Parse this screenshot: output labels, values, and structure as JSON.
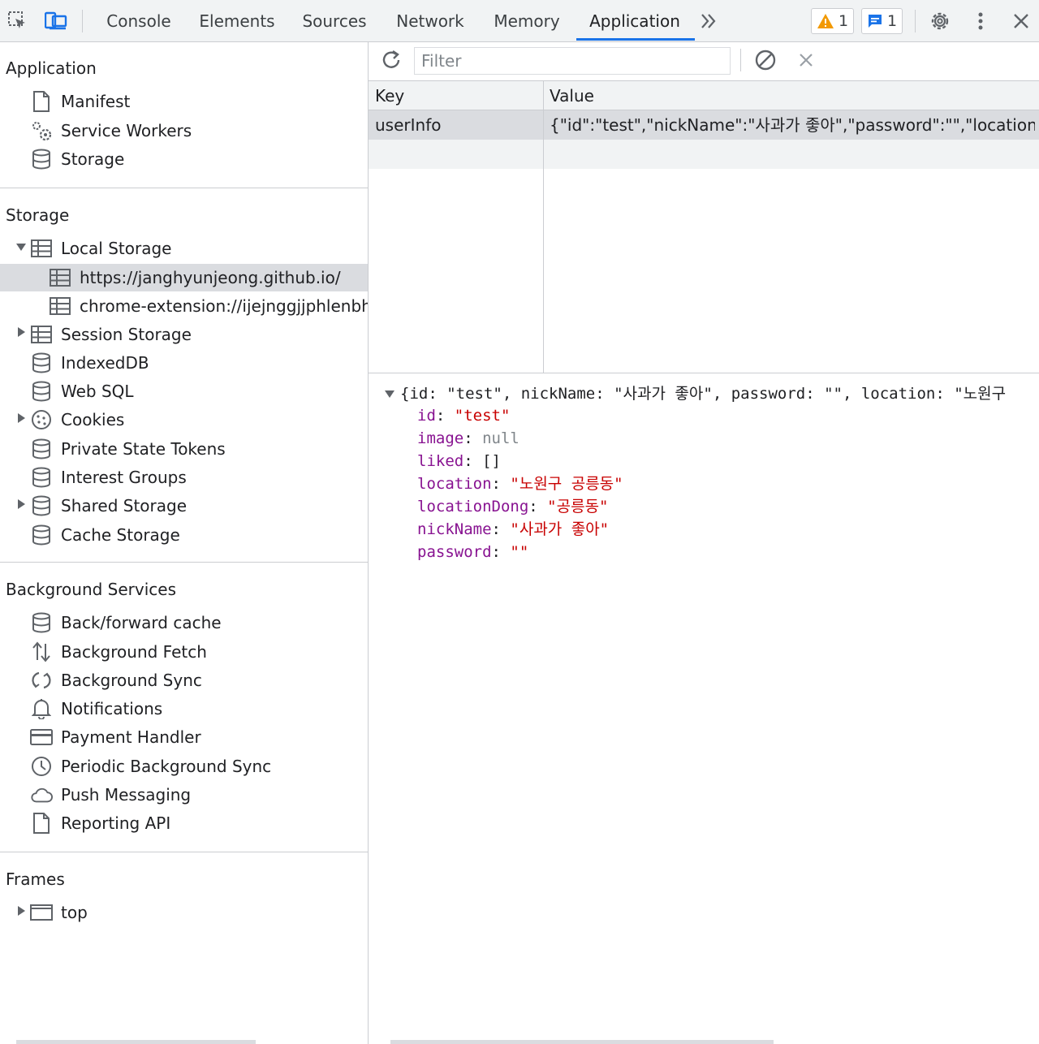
{
  "toolbar": {
    "tabs": [
      "Console",
      "Elements",
      "Sources",
      "Network",
      "Memory",
      "Application"
    ],
    "active_tab": "Application",
    "warnings_count": "1",
    "messages_count": "1"
  },
  "sidebar": {
    "application": {
      "title": "Application",
      "items": [
        "Manifest",
        "Service Workers",
        "Storage"
      ]
    },
    "storage": {
      "title": "Storage",
      "local_storage": "Local Storage",
      "local_storage_children": [
        "https://janghyunjeong.github.io/",
        "chrome-extension://ijejnggjjphlenbhm"
      ],
      "items": [
        "Session Storage",
        "IndexedDB",
        "Web SQL",
        "Cookies",
        "Private State Tokens",
        "Interest Groups",
        "Shared Storage",
        "Cache Storage"
      ]
    },
    "background_services": {
      "title": "Background Services",
      "items": [
        "Back/forward cache",
        "Background Fetch",
        "Background Sync",
        "Notifications",
        "Payment Handler",
        "Periodic Background Sync",
        "Push Messaging",
        "Reporting API"
      ]
    },
    "frames": {
      "title": "Frames",
      "items": [
        "top"
      ]
    }
  },
  "storage_view": {
    "filter_placeholder": "Filter",
    "columns": [
      "Key",
      "Value"
    ],
    "rows": [
      {
        "key": "userInfo",
        "value": "{\"id\":\"test\",\"nickName\":\"사과가 좋아\",\"password\":\"\",\"location..."
      }
    ]
  },
  "preview": {
    "summary": "{id: \"test\", nickName: \"사과가 좋아\", password: \"\", location: \"노원구",
    "props": [
      {
        "key": "id",
        "value": "\"test\"",
        "type": "string"
      },
      {
        "key": "image",
        "value": "null",
        "type": "null"
      },
      {
        "key": "liked",
        "value": "[]",
        "type": "plain"
      },
      {
        "key": "location",
        "value": "\"노원구 공릉동\"",
        "type": "string"
      },
      {
        "key": "locationDong",
        "value": "\"공릉동\"",
        "type": "string"
      },
      {
        "key": "nickName",
        "value": "\"사과가 좋아\"",
        "type": "string"
      },
      {
        "key": "password",
        "value": "\"\"",
        "type": "string"
      }
    ]
  },
  "colors": {
    "accent": "#1a73e8",
    "warning": "#f29900",
    "info": "#1a73e8",
    "json_key": "#881391",
    "json_string": "#c80000"
  }
}
